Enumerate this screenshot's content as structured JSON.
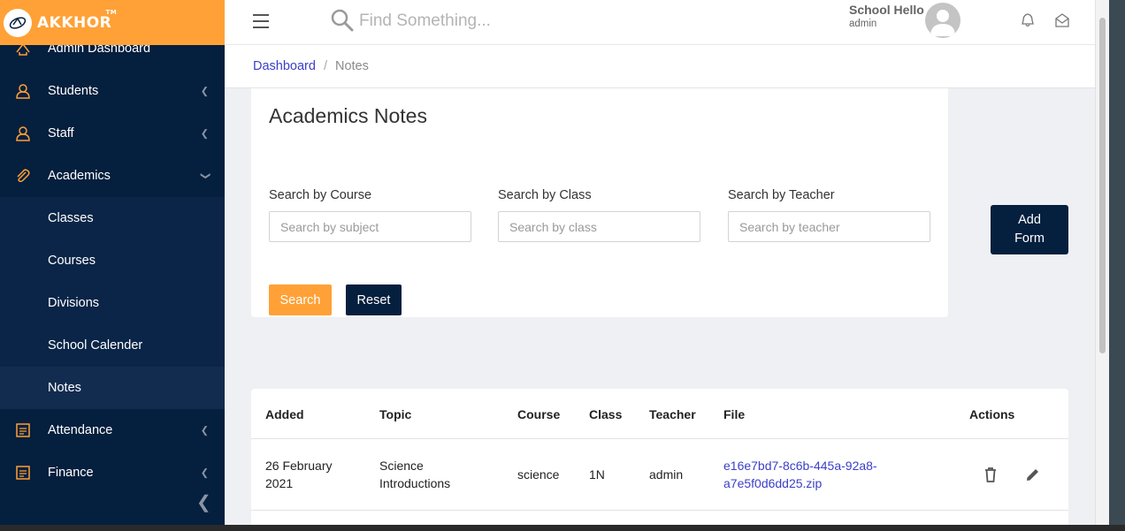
{
  "brand": {
    "name": "AKKHOR",
    "tm": "TM"
  },
  "sidebar": {
    "items": [
      {
        "label": "Admin Dashboard",
        "icon": "dashboard-icon",
        "has_chevron": false
      },
      {
        "label": "Students",
        "icon": "students-icon",
        "has_chevron": true
      },
      {
        "label": "Staff",
        "icon": "staff-icon",
        "has_chevron": true
      },
      {
        "label": "Academics",
        "icon": "paperclip-icon",
        "has_chevron": true,
        "open": true
      },
      {
        "label": "Classes",
        "sub": true
      },
      {
        "label": "Courses",
        "sub": true
      },
      {
        "label": "Divisions",
        "sub": true
      },
      {
        "label": "School Calender",
        "sub": true
      },
      {
        "label": "Notes",
        "sub": true,
        "active": true
      },
      {
        "label": "Attendance",
        "icon": "list-icon",
        "has_chevron": true
      },
      {
        "label": "Finance",
        "icon": "list-icon",
        "has_chevron": true
      }
    ]
  },
  "topbar": {
    "search_placeholder": "Find Something...",
    "user_name": "School Hello",
    "user_role": "admin"
  },
  "breadcrumb": {
    "home": "Dashboard",
    "separator": "/",
    "current": "Notes"
  },
  "filters": {
    "title": "Academics Notes",
    "course_label": "Search by Course",
    "course_placeholder": "Search by subject",
    "class_label": "Search by Class",
    "class_placeholder": "Search by class",
    "teacher_label": "Search by Teacher",
    "teacher_placeholder": "Search by teacher",
    "search_button": "Search",
    "reset_button": "Reset",
    "add_button_line1": "Add",
    "add_button_line2": "Form"
  },
  "table": {
    "headers": [
      "Added",
      "Topic",
      "Course",
      "Class",
      "Teacher",
      "File",
      "Actions"
    ],
    "rows": [
      {
        "added_line1": "26 February",
        "added_line2": "2021",
        "topic_line1": "Science",
        "topic_line2": "Introductions",
        "course": "science",
        "class": "1N",
        "teacher": "admin",
        "file_line1": "e16e7bd7-8c6b-445a-92a8-",
        "file_line2": "a7e5f0d6dd25.zip"
      }
    ]
  },
  "colors": {
    "sidebar": "#051f3e",
    "accent": "#ffa136",
    "link": "#3a3fc8"
  }
}
